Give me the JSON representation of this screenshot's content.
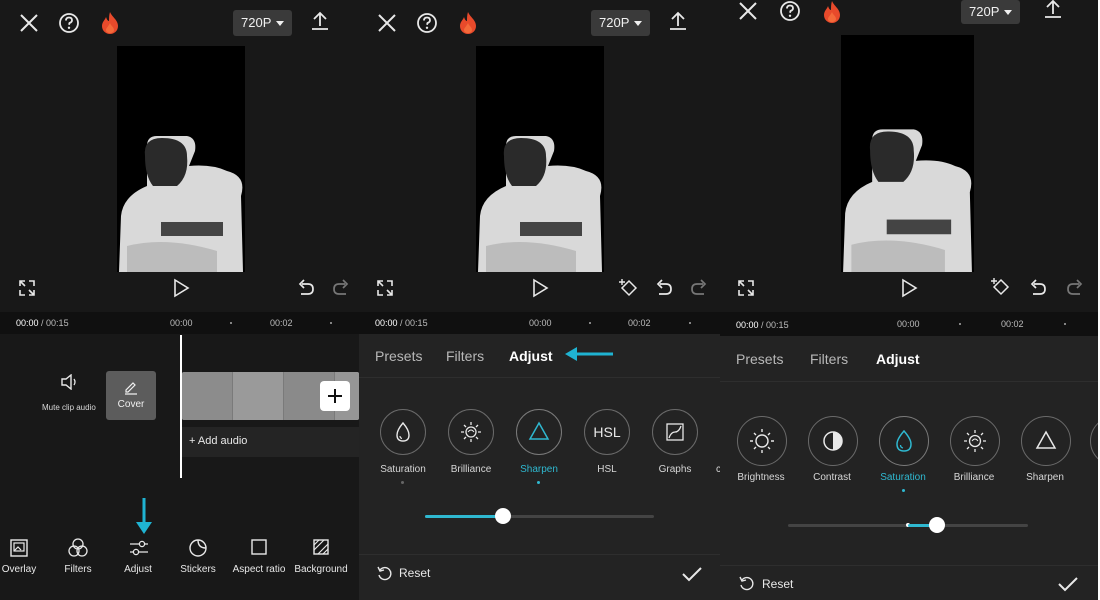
{
  "common": {
    "resolution": "720P",
    "icons": {
      "close": "close-icon",
      "help": "help-icon",
      "flame": "flame-icon",
      "export": "export-icon"
    }
  },
  "panel1": {
    "time_current": "00:00",
    "time_total": "/ 00:15",
    "ruler": [
      "00:00",
      "00:02"
    ],
    "mute_label": "Mute clip audio",
    "cover_label": "Cover",
    "add_audio": "+ Add audio",
    "toolbar": [
      {
        "label": "Overlay",
        "icon": "overlay-icon"
      },
      {
        "label": "Filters",
        "icon": "filters-icon"
      },
      {
        "label": "Adjust",
        "icon": "adjust-icon"
      },
      {
        "label": "Stickers",
        "icon": "stickers-icon"
      },
      {
        "label": "Aspect ratio",
        "icon": "aspect-ratio-icon"
      },
      {
        "label": "Background",
        "icon": "background-icon"
      }
    ],
    "arrow_color": "#1fb3d2"
  },
  "panel2": {
    "time_current": "00:00",
    "time_total": "/ 00:15",
    "ruler": [
      "00:00",
      "00:02"
    ],
    "tabs": [
      "Presets",
      "Filters",
      "Adjust"
    ],
    "active_tab": "Adjust",
    "tools": [
      {
        "label": "Saturation",
        "icon": "saturation-icon"
      },
      {
        "label": "Brilliance",
        "icon": "brilliance-icon"
      },
      {
        "label": "Sharpen",
        "icon": "sharpen-icon"
      },
      {
        "label": "HSL",
        "icon": "hsl-icon"
      },
      {
        "label": "Graphs",
        "icon": "graphs-icon"
      }
    ],
    "selected_tool": "Sharpen",
    "slider_fraction": 0.34,
    "reset": "Reset"
  },
  "panel3": {
    "resolution": "720P",
    "time_current": "00:00",
    "time_total": "/ 00:15",
    "ruler": [
      "00:00",
      "00:02"
    ],
    "tabs": [
      "Presets",
      "Filters",
      "Adjust"
    ],
    "active_tab": "Adjust",
    "tools": [
      {
        "label": "Brightness",
        "icon": "brightness-icon"
      },
      {
        "label": "Contrast",
        "icon": "contrast-icon"
      },
      {
        "label": "Saturation",
        "icon": "saturation-icon"
      },
      {
        "label": "Brilliance",
        "icon": "brilliance-icon"
      },
      {
        "label": "Sharpen",
        "icon": "sharpen-icon"
      }
    ],
    "selected_tool": "Saturation",
    "slider_fraction": 0.62,
    "reset": "Reset"
  },
  "accent": "#2fb8d0"
}
